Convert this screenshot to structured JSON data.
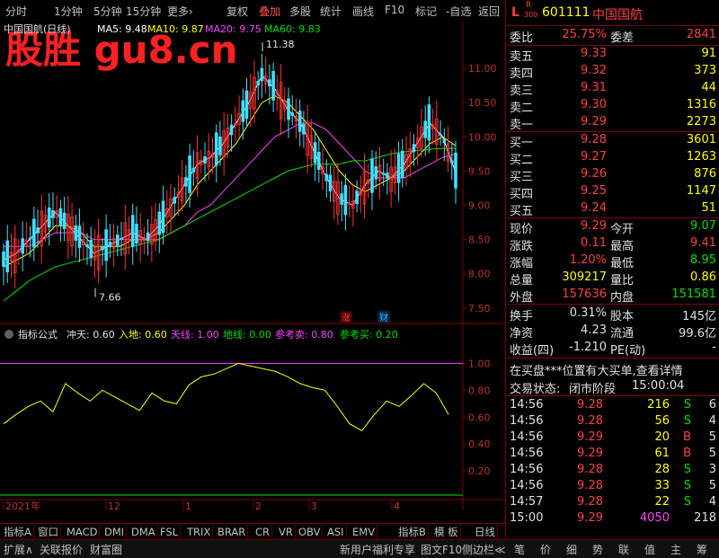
{
  "toolbar": {
    "left_items": [
      "分时",
      "1分钟",
      "5分钟",
      "15分钟",
      "更多›"
    ],
    "right_items": [
      "复权",
      "叠加",
      "多股",
      "统计",
      "画线",
      "F10",
      "标记",
      "-自选",
      "返回"
    ],
    "active_item": "叠加"
  },
  "chart_header": {
    "title": "中国国航(日线)",
    "ma5": "MA5: 9.48",
    "ma10": "MA10: 9.87",
    "ma20": "MA20: 9.75",
    "ma60": "MA60: 9.83",
    "watermark": "股胜 gu8.cn"
  },
  "chart_data": [
    {
      "type": "candlestick",
      "title": "中国国航(日线)",
      "ylim": [
        7.3,
        11.5
      ],
      "y_ticks": [
        "11.00",
        "10.50",
        "10.00",
        "9.50",
        "9.00",
        "8.50",
        "8.00",
        "7.50"
      ],
      "x_ticks": [
        "2021年",
        "12",
        "1",
        "2",
        "3",
        "4"
      ],
      "annotations": [
        {
          "label": "11.38",
          "kind": "high"
        },
        {
          "label": "7.66",
          "kind": "low"
        }
      ],
      "markers": [
        "涨",
        "财"
      ],
      "series": [
        {
          "name": "MA5",
          "values": [
            8.2,
            8.3,
            8.5,
            8.7,
            8.9,
            8.7,
            8.5,
            8.3,
            8.4,
            8.5,
            8.6,
            8.5,
            8.7,
            9.0,
            9.3,
            9.6,
            9.7,
            9.9,
            10.2,
            10.5,
            10.9,
            10.7,
            10.4,
            10.2,
            9.8,
            9.4,
            9.1,
            9.0,
            9.3,
            9.5,
            9.4,
            9.6,
            9.9,
            10.2,
            10.0,
            9.48
          ]
        },
        {
          "name": "MA10",
          "values": [
            8.1,
            8.2,
            8.3,
            8.5,
            8.7,
            8.7,
            8.6,
            8.4,
            8.4,
            8.4,
            8.5,
            8.5,
            8.6,
            8.8,
            9.0,
            9.3,
            9.5,
            9.7,
            9.9,
            10.2,
            10.5,
            10.6,
            10.5,
            10.3,
            10.1,
            9.8,
            9.5,
            9.3,
            9.2,
            9.3,
            9.4,
            9.5,
            9.7,
            9.9,
            10.0,
            9.87
          ]
        },
        {
          "name": "MA20",
          "values": [
            8.4,
            8.4,
            8.4,
            8.5,
            8.6,
            8.6,
            8.6,
            8.5,
            8.5,
            8.5,
            8.5,
            8.5,
            8.5,
            8.6,
            8.7,
            8.9,
            9.0,
            9.2,
            9.4,
            9.6,
            9.8,
            10.0,
            10.1,
            10.2,
            10.2,
            10.1,
            9.9,
            9.7,
            9.5,
            9.4,
            9.4,
            9.4,
            9.5,
            9.6,
            9.7,
            9.75
          ]
        },
        {
          "name": "MA60",
          "values": [
            7.6,
            7.75,
            7.9,
            8.0,
            8.1,
            8.15,
            8.2,
            8.25,
            8.3,
            8.35,
            8.4,
            8.45,
            8.5,
            8.6,
            8.7,
            8.8,
            8.9,
            9.0,
            9.1,
            9.2,
            9.3,
            9.4,
            9.5,
            9.55,
            9.6,
            9.6,
            9.6,
            9.65,
            9.65,
            9.7,
            9.75,
            9.78,
            9.8,
            9.82,
            9.83,
            9.83
          ]
        }
      ],
      "colors": {
        "MA5": "#ffffff",
        "MA10": "#ffff00",
        "MA20": "#ff40ff",
        "MA60": "#00e000",
        "up": "#ff3030",
        "down": "#40e0ff"
      }
    },
    {
      "type": "line",
      "title": "指标公式",
      "ylim": [
        0.0,
        1.15
      ],
      "y_ticks": [
        "1.00",
        "0.80",
        "0.60",
        "0.40",
        "0.20"
      ],
      "legend": [
        {
          "label": "冲天: 0.60",
          "color": "#e0e0e0"
        },
        {
          "label": "入地: 0.60",
          "color": "#ffff00"
        },
        {
          "label": "天线: 1.00",
          "color": "#ff40ff"
        },
        {
          "label": "地线: 0.00",
          "color": "#00e000"
        },
        {
          "label": "参考卖: 0.80",
          "color": "#ff40ff"
        },
        {
          "label": "参考买: 0.20",
          "color": "#00e000"
        }
      ],
      "series": [
        {
          "name": "冲天",
          "values": [
            0.55,
            0.62,
            0.68,
            0.72,
            0.64,
            0.85,
            0.78,
            0.72,
            0.8,
            0.75,
            0.7,
            0.65,
            0.78,
            0.72,
            0.7,
            0.84,
            0.9,
            0.92,
            0.96,
            1.0,
            0.98,
            0.96,
            0.94,
            0.9,
            0.85,
            0.82,
            0.8,
            0.68,
            0.55,
            0.5,
            0.62,
            0.72,
            0.68,
            0.76,
            0.85,
            0.78,
            0.62
          ]
        },
        {
          "name": "天线",
          "values": [
            1.0
          ]
        },
        {
          "name": "地线",
          "values": [
            0.0
          ]
        }
      ]
    }
  ],
  "bottom_tabs": [
    "指标A",
    "窗口",
    "MACD",
    "DMI",
    "DMA",
    "FSL",
    "TRIX",
    "BRAR",
    "CR",
    "VR",
    "OBV",
    "ASI",
    "EMV",
    "指标B",
    "模 板",
    "日线"
  ],
  "status_bar": {
    "items": [
      "扩展∧",
      "关联报价",
      "财富圈"
    ],
    "mid": "新用户福利专享",
    "f10": "图文F10",
    "side": "侧边栏≪",
    "right_icons": [
      "笔",
      "价",
      "细",
      "势",
      "联",
      "值",
      "主",
      "筹"
    ]
  },
  "quote": {
    "code": "601111",
    "name": "中国国航",
    "lr_label": "L",
    "r_label": "R",
    "num_300": "300",
    "wei_bi_label": "委比",
    "wei_bi": "25.75%",
    "wei_cha_label": "委差",
    "wei_cha": "2841",
    "asks": [
      {
        "label": "卖五",
        "price": "9.33",
        "vol": "91"
      },
      {
        "label": "卖四",
        "price": "9.32",
        "vol": "373"
      },
      {
        "label": "卖三",
        "price": "9.31",
        "vol": "44"
      },
      {
        "label": "卖二",
        "price": "9.30",
        "vol": "1316"
      },
      {
        "label": "卖一",
        "price": "9.29",
        "vol": "2273"
      }
    ],
    "bids": [
      {
        "label": "买一",
        "price": "9.28",
        "vol": "3601"
      },
      {
        "label": "买二",
        "price": "9.27",
        "vol": "1263"
      },
      {
        "label": "买三",
        "price": "9.26",
        "vol": "876"
      },
      {
        "label": "买四",
        "price": "9.25",
        "vol": "1147"
      },
      {
        "label": "买五",
        "price": "9.24",
        "vol": "51"
      }
    ],
    "stats": [
      {
        "l1": "现价",
        "v1": "9.29",
        "c1": "red",
        "l2": "今开",
        "v2": "9.07",
        "c2": "green"
      },
      {
        "l1": "涨跌",
        "v1": "0.11",
        "c1": "red",
        "l2": "最高",
        "v2": "9.41",
        "c2": "red"
      },
      {
        "l1": "涨幅",
        "v1": "1.20%",
        "c1": "red",
        "l2": "最低",
        "v2": "8.95",
        "c2": "green"
      },
      {
        "l1": "总量",
        "v1": "309217",
        "c1": "yellow",
        "l2": "量比",
        "v2": "0.86",
        "c2": "yellow"
      },
      {
        "l1": "外盘",
        "v1": "157636",
        "c1": "red",
        "l2": "内盘",
        "v2": "151581",
        "c2": "green"
      }
    ],
    "stats2": [
      {
        "l1": "换手",
        "v1": "0.31%",
        "l2": "股本",
        "v2": "145亿"
      },
      {
        "l1": "净资",
        "v1": "4.23",
        "l2": "流通",
        "v2": "99.6亿"
      },
      {
        "l1": "收益(四)",
        "v1": "-1.210",
        "l2": "PE(动)",
        "v2": "-"
      }
    ],
    "notice": "在买盘***位置有大买单,查看详情",
    "trade_state_label": "交易状态:",
    "trade_state": "闭市阶段",
    "trade_time": "15:00:04",
    "ticks": [
      {
        "time": "14:56",
        "price": "9.28",
        "vol": "216",
        "side": "S",
        "n": "6"
      },
      {
        "time": "14:56",
        "price": "9.28",
        "vol": "56",
        "side": "S",
        "n": "4"
      },
      {
        "time": "14:56",
        "price": "9.29",
        "vol": "20",
        "side": "B",
        "n": "5"
      },
      {
        "time": "14:56",
        "price": "9.29",
        "vol": "61",
        "side": "B",
        "n": "5"
      },
      {
        "time": "14:56",
        "price": "9.28",
        "vol": "28",
        "side": "S",
        "n": "3"
      },
      {
        "time": "14:56",
        "price": "9.28",
        "vol": "33",
        "side": "S",
        "n": "5"
      },
      {
        "time": "14:57",
        "price": "9.28",
        "vol": "22",
        "side": "S",
        "n": "4"
      },
      {
        "time": "15:00",
        "price": "9.29",
        "vol": "4050",
        "side": "",
        "n": "218"
      }
    ]
  }
}
